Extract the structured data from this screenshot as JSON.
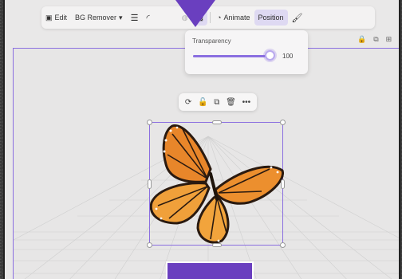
{
  "toolbar": {
    "edit_label": "Edit",
    "bg_remover_label": "BG Remover",
    "animate_label": "Animate",
    "position_label": "Position"
  },
  "transparency": {
    "label": "Transparency",
    "value": 100,
    "value_text": "100"
  },
  "colors": {
    "accent": "#8b6fe0",
    "pointer": "#6a3fbf",
    "canvas": "#e7e6e6"
  },
  "icons": {
    "toolbar": [
      "edit-icon",
      "chevron-down-icon",
      "lines-icon",
      "corner-rounding-icon",
      "paint-icon",
      "transparency-checker-icon",
      "animate-icon",
      "paint-format-icon"
    ],
    "page_actions": [
      "lock-icon",
      "duplicate-page-icon",
      "add-page-icon"
    ],
    "selection_toolbar": [
      "rotate-icon",
      "lock-icon",
      "copy-icon",
      "trash-icon",
      "more-icon"
    ]
  }
}
